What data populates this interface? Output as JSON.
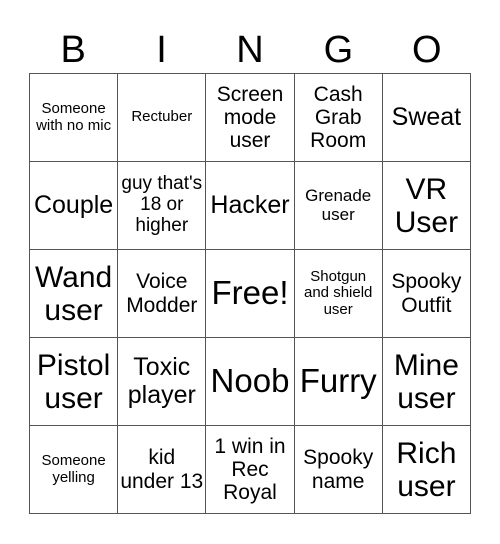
{
  "header": {
    "letters": [
      "B",
      "I",
      "N",
      "G",
      "O"
    ]
  },
  "cells": [
    {
      "text": "Someone with no mic"
    },
    {
      "text": "Rectuber"
    },
    {
      "text": "Screen mode user"
    },
    {
      "text": "Cash Grab Room"
    },
    {
      "text": "Sweat"
    },
    {
      "text": "Couple"
    },
    {
      "text": "guy that's 18 or higher"
    },
    {
      "text": "Hacker"
    },
    {
      "text": "Grenade user"
    },
    {
      "text": "VR User"
    },
    {
      "text": "Wand user"
    },
    {
      "text": "Voice Modder"
    },
    {
      "text": "Free!"
    },
    {
      "text": "Shotgun and shield user"
    },
    {
      "text": "Spooky Outfit"
    },
    {
      "text": "Pistol user"
    },
    {
      "text": "Toxic player"
    },
    {
      "text": "Noob"
    },
    {
      "text": "Furry"
    },
    {
      "text": "Mine user"
    },
    {
      "text": "Someone yelling"
    },
    {
      "text": "kid under 13"
    },
    {
      "text": "1 win in Rec Royal"
    },
    {
      "text": "Spooky name"
    },
    {
      "text": "Rich user"
    }
  ]
}
